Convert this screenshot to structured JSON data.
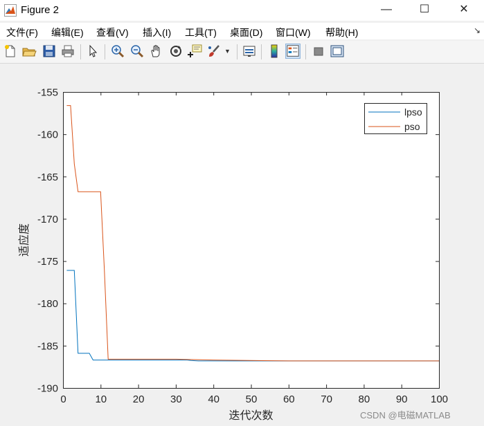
{
  "window": {
    "title": "Figure 2",
    "controls": {
      "minimize": "—",
      "maximize": "☐",
      "close": "✕"
    }
  },
  "menu": {
    "items": [
      "文件(F)",
      "编辑(E)",
      "查看(V)",
      "插入(I)",
      "工具(T)",
      "桌面(D)",
      "窗口(W)",
      "帮助(H)"
    ],
    "overflow_icon": "dock-arrow-icon"
  },
  "toolbar": {
    "buttons": [
      "new-figure-icon",
      "open-file-icon",
      "save-icon",
      "print-icon",
      "select-arrow-icon",
      "zoom-in-icon",
      "zoom-out-icon",
      "pan-hand-icon",
      "rotate-3d-icon",
      "data-cursor-icon",
      "brush-icon",
      "brush-dropdown-icon",
      "link-plot-icon",
      "colorbar-icon",
      "legend-icon",
      "hide-plot-tools-icon",
      "show-plot-tools-icon"
    ]
  },
  "watermark": "CSDN @电磁MATLAB",
  "colors": {
    "lpso": "#0072bd",
    "pso": "#d95319"
  },
  "chart_data": {
    "type": "line",
    "title": "",
    "xlabel": "迭代次数",
    "ylabel": "适应度",
    "xlim": [
      0,
      100
    ],
    "ylim": [
      -190,
      -155
    ],
    "xticks": [
      0,
      10,
      20,
      30,
      40,
      50,
      60,
      70,
      80,
      90,
      100
    ],
    "yticks": [
      -155,
      -160,
      -165,
      -170,
      -175,
      -180,
      -185,
      -190
    ],
    "grid": false,
    "legend_position": "top-right",
    "series": [
      {
        "name": "lpso",
        "x": [
          1,
          2,
          3,
          4,
          5,
          6,
          7,
          8,
          10,
          12,
          20,
          30,
          33,
          34,
          36,
          40,
          60,
          80,
          100
        ],
        "y": [
          -176.1,
          -176.1,
          -176.1,
          -185.9,
          -185.9,
          -185.9,
          -185.9,
          -186.7,
          -186.7,
          -186.7,
          -186.7,
          -186.7,
          -186.7,
          -186.75,
          -186.8,
          -186.8,
          -186.8,
          -186.8,
          -186.8
        ]
      },
      {
        "name": "pso",
        "x": [
          1,
          2,
          3,
          4,
          5,
          6,
          8,
          10,
          11,
          12,
          13,
          20,
          30,
          40,
          60,
          80,
          100
        ],
        "y": [
          -156.6,
          -156.6,
          -163.5,
          -166.8,
          -166.8,
          -166.8,
          -166.8,
          -166.8,
          -176.0,
          -186.6,
          -186.6,
          -186.6,
          -186.6,
          -186.7,
          -186.8,
          -186.8,
          -186.8
        ]
      }
    ]
  }
}
